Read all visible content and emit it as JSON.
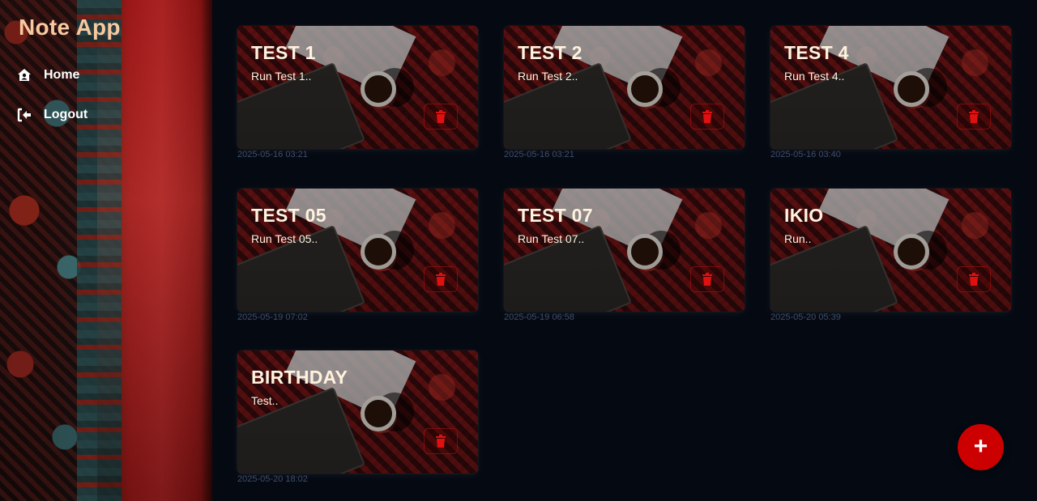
{
  "sidebar": {
    "app_title": "Note App",
    "nav": [
      {
        "label": "Home",
        "icon": "home-icon"
      },
      {
        "label": "Logout",
        "icon": "logout-icon"
      }
    ]
  },
  "notes": [
    {
      "title": "TEST 1",
      "preview": "Run Test 1..",
      "date": "2025-05-16 03:21"
    },
    {
      "title": "TEST 2",
      "preview": "Run Test 2..",
      "date": "2025-05-16 03:21"
    },
    {
      "title": "TEST 4",
      "preview": "Run Test 4..",
      "date": "2025-05-16 03:40"
    },
    {
      "title": "TEST 05",
      "preview": "Run Test 05..",
      "date": "2025-05-19 07:02"
    },
    {
      "title": "TEST 07",
      "preview": "Run Test 07..",
      "date": "2025-05-19 06:58"
    },
    {
      "title": "IKIO",
      "preview": "Run..",
      "date": "2025-05-20 05:39"
    },
    {
      "title": "BIRTHDAY",
      "preview": "Test..",
      "date": "2025-05-20 18:02"
    }
  ],
  "fab": {
    "label": "+",
    "icon": "plus-icon"
  },
  "colors": {
    "accent": "#cc0000",
    "title_text": "#f7c9a0",
    "card_text": "#fff3df",
    "date_text": "#3f4f6b",
    "background": "#050912"
  }
}
